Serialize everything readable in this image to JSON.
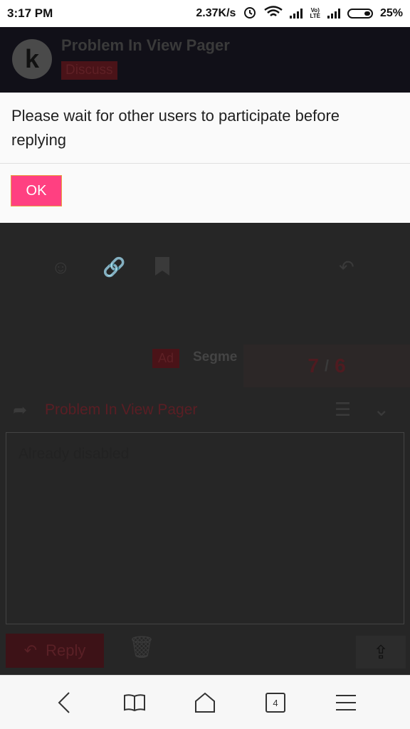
{
  "status_bar": {
    "time": "3:17 PM",
    "net_speed": "2.37K/s",
    "lte_top": "Vo)",
    "lte_bottom": "LTE",
    "battery_pct": "25%"
  },
  "header": {
    "logo_letter": "k",
    "title": "Problem In View Pager",
    "category": "Discuss"
  },
  "post_actions": [
    "smile-icon",
    "link-icon",
    "bookmark-icon",
    "reply-arrow-icon"
  ],
  "ad": {
    "badge": "Ad",
    "text": "Segme"
  },
  "counter": {
    "current": "7",
    "separator": "/",
    "total": "6"
  },
  "reply": {
    "topic_title": "Problem In View Pager",
    "text": "Already disabled",
    "submit_label": "Reply"
  },
  "dialog": {
    "message": "Please wait for other users to participate before replying",
    "ok_label": "OK"
  },
  "nav": {
    "tab_count": "4"
  },
  "colors": {
    "accent": "#ff4081",
    "dialog_bg": "#fafafa",
    "overlay": "#262626"
  }
}
